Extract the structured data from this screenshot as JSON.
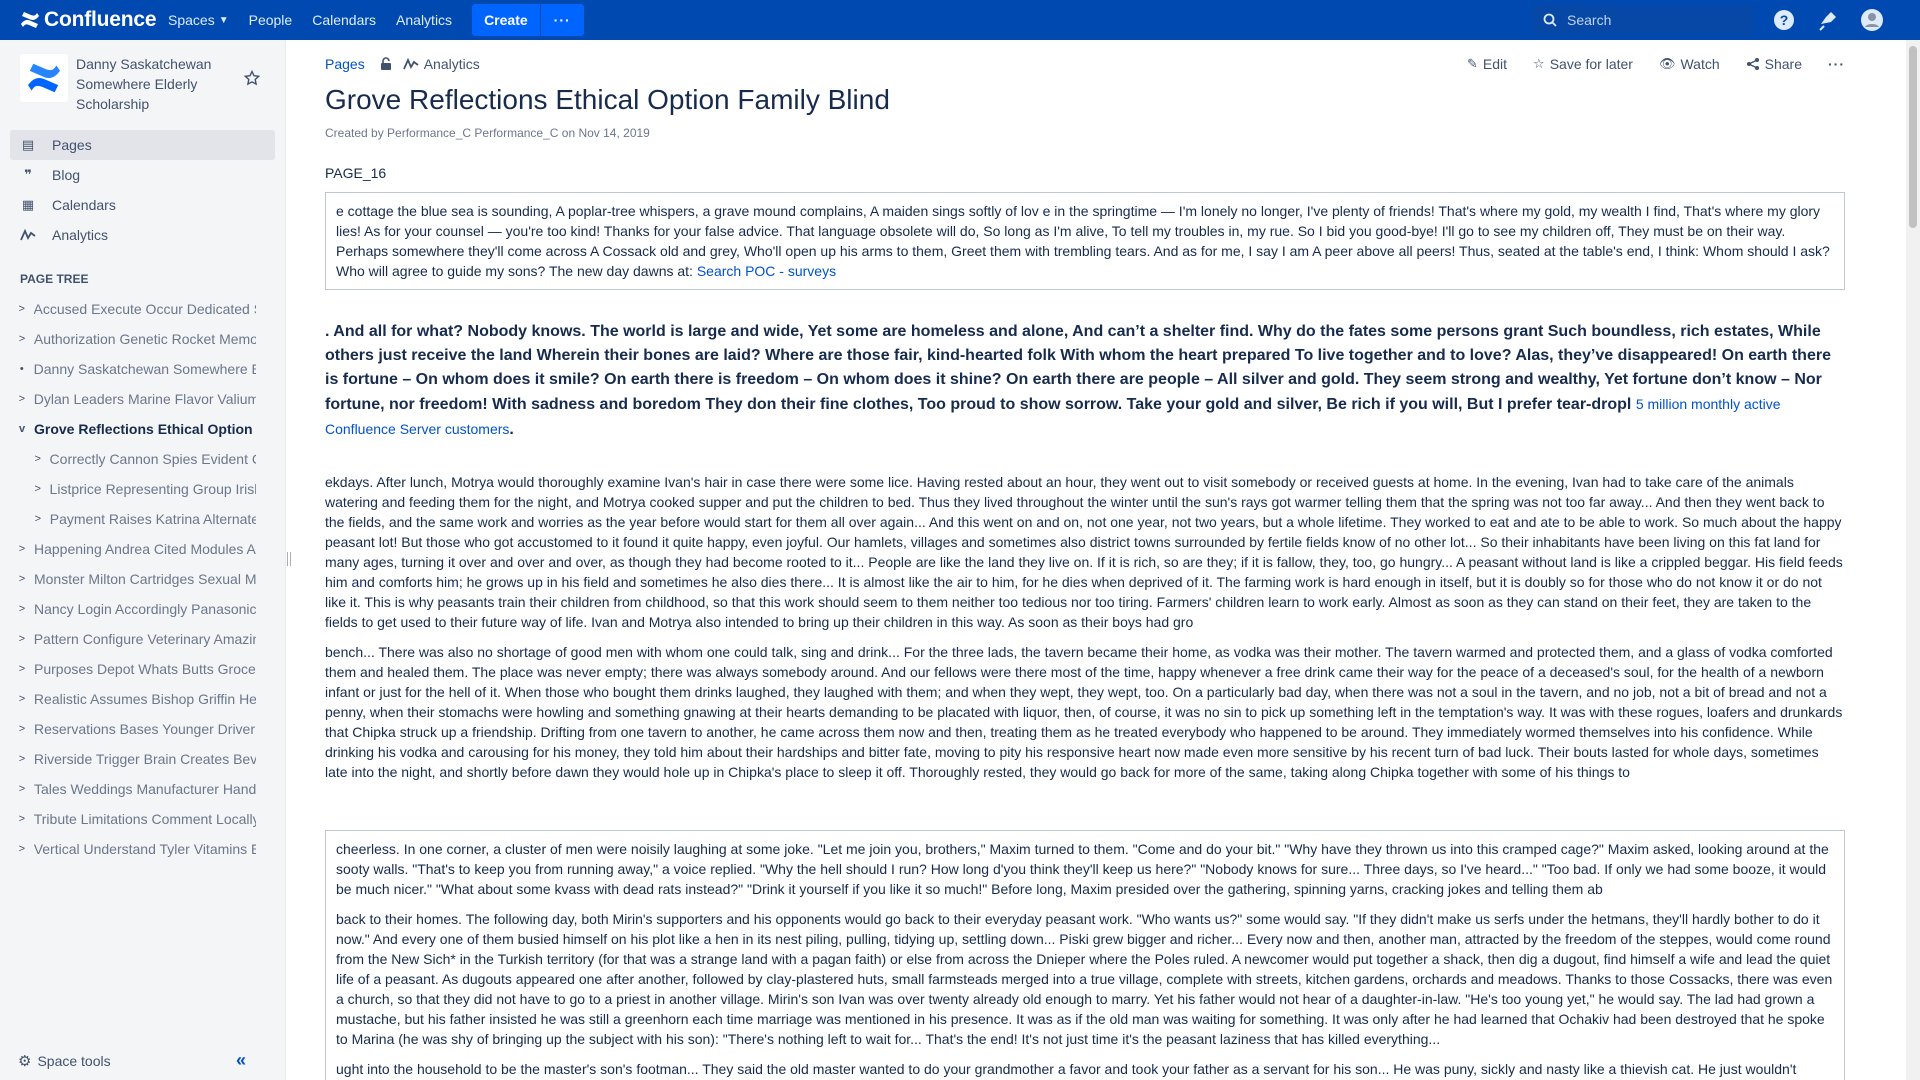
{
  "nav": {
    "product": "Confluence",
    "items": [
      {
        "label": "Spaces",
        "dropdown": true
      },
      {
        "label": "People"
      },
      {
        "label": "Calendars"
      },
      {
        "label": "Analytics"
      }
    ],
    "create_label": "Create",
    "more_label": "···",
    "search_placeholder": "Search"
  },
  "sidebar": {
    "space_name": "Danny Saskatchewan Somewhere Elderly Scholarship",
    "links": [
      {
        "label": "Pages",
        "icon": "pages-icon"
      },
      {
        "label": "Blog",
        "icon": "quote-icon"
      },
      {
        "label": "Calendars",
        "icon": "calendar-icon"
      },
      {
        "label": "Analytics",
        "icon": "analytics-icon"
      }
    ],
    "tree_title": "PAGE TREE",
    "tree": [
      {
        "label": "Accused Execute Occur Dedicated S",
        "chev": ">"
      },
      {
        "label": "Authorization Genetic Rocket Memo",
        "chev": ">"
      },
      {
        "label": "Danny Saskatchewan Somewhere E",
        "chev": "•"
      },
      {
        "label": "Dylan Leaders Marine Flavor Valium",
        "chev": ">"
      },
      {
        "label": "Grove Reflections Ethical Option",
        "chev": "v"
      },
      {
        "label": "Correctly Cannon Spies Evident C",
        "chev": ">"
      },
      {
        "label": "Listprice Representing Group Irish",
        "chev": ">"
      },
      {
        "label": "Payment Raises Katrina Alternate",
        "chev": ">"
      },
      {
        "label": "Happening Andrea Cited Modules A",
        "chev": ">"
      },
      {
        "label": "Monster Milton Cartridges Sexual M",
        "chev": ">"
      },
      {
        "label": "Nancy Login Accordingly Panasonic",
        "chev": ">"
      },
      {
        "label": "Pattern Configure Veterinary Amazin",
        "chev": ">"
      },
      {
        "label": "Purposes Depot Whats Butts Groce",
        "chev": ">"
      },
      {
        "label": "Realistic Assumes Bishop Griffin He",
        "chev": ">"
      },
      {
        "label": "Reservations Bases Younger Driver",
        "chev": ">"
      },
      {
        "label": "Riverside Trigger Brain Creates Bev",
        "chev": ">"
      },
      {
        "label": "Tales Weddings Manufacturer Hand",
        "chev": ">"
      },
      {
        "label": "Tribute Limitations Comment Locally",
        "chev": ">"
      },
      {
        "label": "Vertical Understand Tyler Vitamins E",
        "chev": ">"
      }
    ],
    "space_tools": "Space tools",
    "collapse": "«"
  },
  "page": {
    "breadcrumb_pages": "Pages",
    "breadcrumb_analytics": "Analytics",
    "actions": {
      "edit": "Edit",
      "save": "Save for later",
      "watch": "Watch",
      "share": "Share",
      "more": "···"
    },
    "title": "Grove Reflections Ethical Option Family Blind",
    "byline": "Created by Performance_C Performance_C on Nov 14, 2019",
    "label": "PAGE_16",
    "panel1_text": " e cottage the blue sea is sounding, A poplar-tree whispers, a grave mound complains, A maiden sings softly of lov e in the springtime — I'm lonely no longer, I've plenty of friends! That's where my gold, my wealth I find, That's where my glory lies! As for your counsel — you're too kind! Thanks for your false advice. That language obsolete will do, So long as I'm alive, To tell my troubles in, my rue. So I bid you good-bye! I'll go to see my children off, They must be on their way. Perhaps somewhere they'll come across A Cossack old and grey, Who'll open up his arms to them, Greet them with trembling tears. And as for me, I say I am A peer above all peers! Thus, seated at the table's end, I think: Whom should I ask? Who will agree to guide my sons? The new day dawns at: ",
    "panel1_link": "Search POC - surveys",
    "bold_text": ". And all for what? Nobody knows. The world is large and wide, Yet some are homeless and alone, And can’t a shelter find. Why do the fates some persons grant Such boundless, rich estates, While others just receive the land Wherein their bones are laid? Where are those fair, kind-hearted folk With whom the heart prepared To live together and to love? Alas, they’ve disappeared! On earth there is fortune – On whom does it smile? On earth there is freedom – On whom does it shine? On earth there are people – All silver and gold. They seem strong and wealthy, Yet fortune don’t know – Nor fortune, nor freedom! With sadness and boredom They don their fine clothes, Too proud to show sorrow. Take your gold and silver, Be rich if you will, But I prefer tear-dropl ",
    "bold_link": "5 million monthly active Confluence Server customers",
    "bold_after": ".",
    "para1": "ekdays. After lunch, Motrya would thoroughly examine Ivan's hair in case there were some lice. Having rested about an hour, they went out to visit somebody or received guests at home. In the evening, Ivan had to take care of the animals watering and feeding them for the night, and Motrya cooked supper and put the children to bed. Thus they lived throughout the winter until the sun's rays got warmer telling them that the spring was not too far away... And then they went back to the fields, and the same work and worries as the year before would start for them all over again... And this went on and on, not one year, not two years, but a whole lifetime. They worked to eat and ate to be able to work. So much about the happy peasant lot! But those who got accustomed to it found it quite happy, even joyful. Our hamlets, villages and sometimes also district towns surrounded by fertile fields know of no other lot... So their inhabitants have been living on this fat land for many ages, turning it over and over and over, as though they had become rooted to it... People are like the land they live on. If it is rich, so are they; if it is fallow, they, too, go hungry... A peasant without land is like a crippled beggar. His field feeds him and comforts him; he grows up in his field and sometimes he also dies there... It is almost like the air to him, for he dies when deprived of it. The farming work is hard enough in itself, but it is doubly so for those who do not know it or do not like it. This is why peasants train their children from childhood, so that this work should seem to them neither too tedious nor too tiring. Farmers' children learn to work early. Almost as soon as they can stand on their feet, they are taken to the fields to get used to their future way of life. Ivan and Motrya also intended to bring up their children in this way. As soon as their boys had gro",
    "para2": "bench... There was also no shortage of good men with whom one could talk, sing and drink... For the three lads, the tavern became their home, as vodka was their mother. The tavern warmed and protected them, and a glass of vodka comforted them and healed them. The place was never empty; there was always somebody around. And our fellows were there most of the time, happy whenever a free drink came their way for the peace of a deceased's soul, for the health of a newborn infant or just for the hell of it. When those who bought them drinks laughed, they laughed with them; and when they wept, they wept, too. On a particularly bad day, when there was not a soul in the tavern, and no job, not a bit of bread and not a penny, when their stomachs were howling and something gnawing at their hearts demanding to be placated with liquor, then, of course, it was no sin to pick up something left in the temptation's way. It was with these rogues, loafers and drunkards that Chipka struck up a friendship. Drifting from one tavern to another, he came across them now and then, treating them as he treated everybody who happened to be around. They immediately wormed themselves into his confidence. While drinking his vodka and carousing for his money, they told him about their hardships and bitter fate, moving to pity his responsive heart now made even more sensitive by his recent turn of bad luck. Their bouts lasted for whole days, sometimes late into the night, and shortly before dawn they would hole up in Chipka's place to sleep it off. Thoroughly rested, they would go back for more of the same, taking along Chipka together with some of his things to",
    "panel2_paras": [
      "cheerless. In one corner, a cluster of men were noisily laughing at some joke. \"Let me join you, brothers,\" Maxim turned to them. \"Come and do your bit.\" \"Why have they thrown us into this cramped cage?\" Maxim asked, looking around at the sooty walls. \"That's to keep you from running away,\" a voice replied. \"Why the hell should I run? How long d'you think they'll keep us here?\" \"Nobody knows for sure... Three days, so I've heard...\" \"Too bad. If only we had some booze, it would be much nicer.\" \"What about some kvass with dead rats instead?\" \"Drink it yourself if you like it so much!\" Before long, Maxim presided over the gathering, spinning yarns, cracking jokes and telling them ab",
      "back to their homes. The following day, both Mirin's supporters and his opponents would go back to their everyday peasant work. \"Who wants us?\" some would say. \"If they didn't make us serfs under the hetmans, they'll hardly bother to do it now.\" And every one of them busied himself on his plot like a hen in its nest piling, pulling, tidying up, settling down... Piski grew bigger and richer... Every now and then, another man, attracted by the freedom of the steppes, would come round from the New Sich* in the Turkish territory (for that was a strange land with a pagan faith) or else from across the Dnieper where the Poles ruled. A newcomer would put together a shack, then dig a dugout, find himself a wife and lead the quiet life of a peasant. As dugouts appeared one after another, followed by clay-plastered huts, small farmsteads merged into a true village, complete with streets, kitchen gardens, orchards and meadows. Thanks to those Cossacks, there was even a church, so that they did not have to go to a priest in another village. Mirin's son Ivan was over twenty already old enough to marry. Yet his father would not hear of a daughter-in-law. \"He's too young yet,\" he would say. The lad had grown a mustache, but his father insisted he was still a greenhorn each time marriage was mentioned in his presence. It was as if the old man was waiting for something. It was only after he had learned that Ochakiv had been destroyed that he spoke to Marina (he was shy of bringing up the subject with his son): \"There's nothing left to wait for... That's the end! It's not just time it's the peasant laziness that has killed everything...",
      "ught into the household to be the master's son's footman... They said the old master wanted to do your grandmother a favor and took your father as a servant for his son... He was puny, sickly and nasty like a thievish cat. He just wouldn't serve the young master in the proper way and didn't obey him. The young master once pinched him or pulled his hair... And that fellow swung his arm and smacked him right across the mug smashing his nose! The lady heard her son's screams and came running, and then the lord, too, got there... 'Take him to the stable!' he ordered. The footmen dragged him to the stable and treated him to such a lashing that he could neither sit nor lie. And he couldn't even complain to"
    ]
  }
}
